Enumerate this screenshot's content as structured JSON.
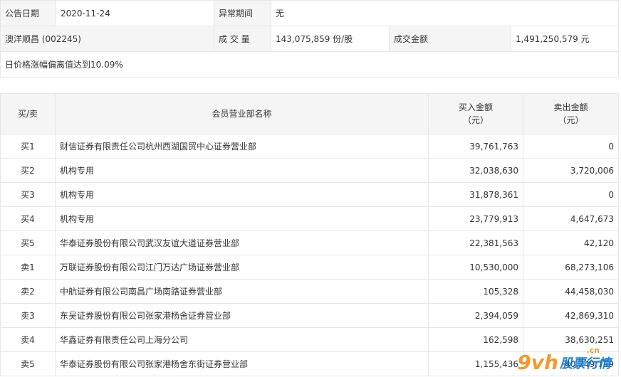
{
  "header": {
    "date_label": "公告日期",
    "date_value": "2020-11-24",
    "abnormal_label": "异常期间",
    "abnormal_value": "无",
    "stock_name": "澳洋顺昌 (002245)",
    "volume_label": "成 交 量",
    "volume_value": "143,075,859 份/股",
    "amount_label": "成交金额",
    "amount_value": "1,491,250,579 元",
    "reason": "日价格涨幅偏离值达到10.09%"
  },
  "table": {
    "col_side": "买/卖",
    "col_name": "会员营业部名称",
    "col_buy_1": "买入金额",
    "col_buy_2": "（元）",
    "col_sell_1": "卖出金额",
    "col_sell_2": "（元）",
    "rows": [
      {
        "side": "买1",
        "name": "财信证券有限责任公司杭州西湖国贸中心证券营业部",
        "buy": "39,761,763",
        "sell": "0"
      },
      {
        "side": "买2",
        "name": "机构专用",
        "buy": "32,038,630",
        "sell": "3,720,006"
      },
      {
        "side": "买3",
        "name": "机构专用",
        "buy": "31,878,361",
        "sell": "0"
      },
      {
        "side": "买4",
        "name": "机构专用",
        "buy": "23,779,913",
        "sell": "4,647,673"
      },
      {
        "side": "买5",
        "name": "华泰证券股份有限公司武汉友谊大道证券营业部",
        "buy": "22,381,563",
        "sell": "42,120"
      },
      {
        "side": "卖1",
        "name": "万联证券股份有限公司江门万达广场证券营业部",
        "buy": "10,530,000",
        "sell": "68,273,106"
      },
      {
        "side": "卖2",
        "name": "中航证券有限公司南昌广场南路证券营业部",
        "buy": "105,328",
        "sell": "44,458,030"
      },
      {
        "side": "卖3",
        "name": "东吴证券股份有限公司张家港杨舍证券营业部",
        "buy": "2,394,059",
        "sell": "42,869,310"
      },
      {
        "side": "卖4",
        "name": "华鑫证券有限责任公司上海分公司",
        "buy": "162,598",
        "sell": "38,630,251"
      },
      {
        "side": "卖5",
        "name": "华泰证券股份有限公司张家港杨舍东街证券营业部",
        "buy": "1,155,436",
        "sell": "40,749,759"
      }
    ]
  },
  "watermark": {
    "logo": "9vh",
    "domain": ".cn",
    "text": "股票行情"
  }
}
